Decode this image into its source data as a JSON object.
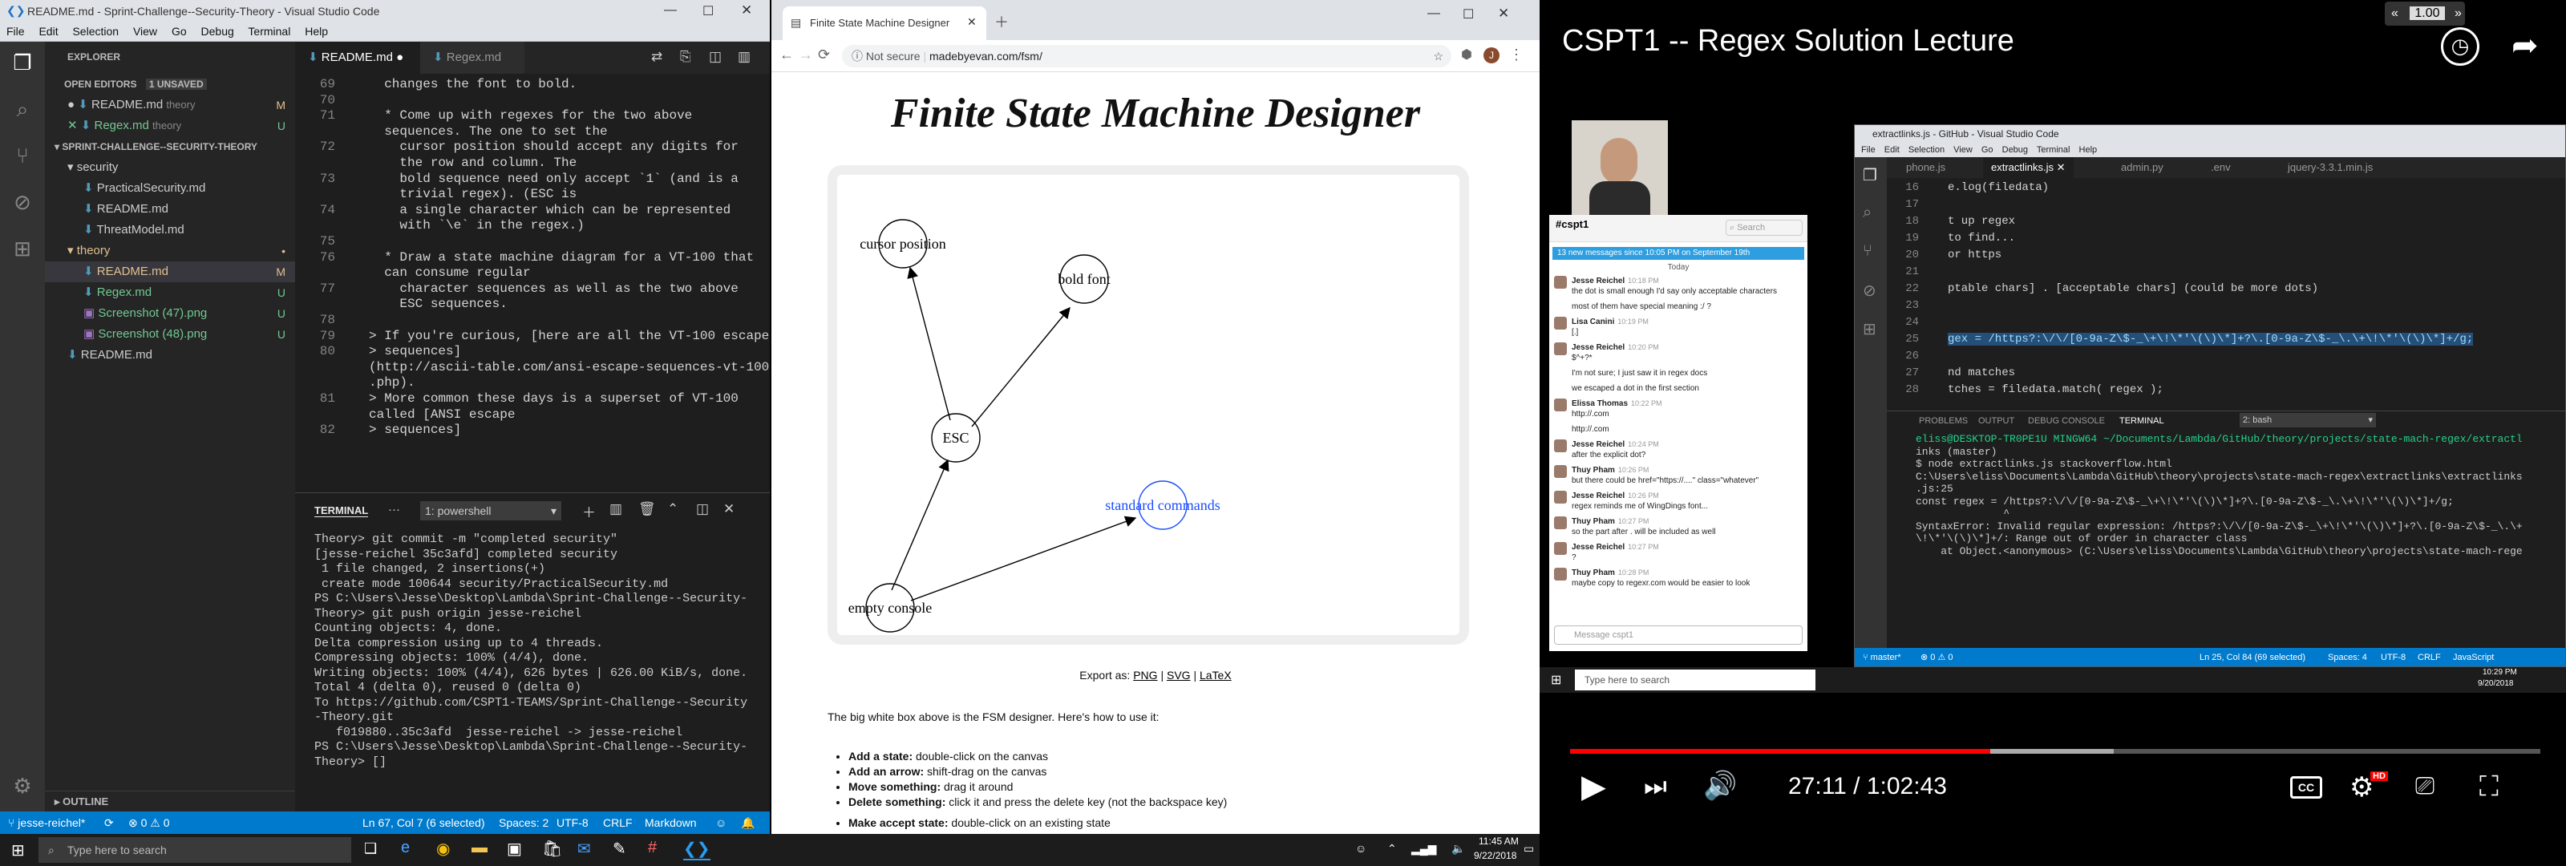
{
  "vscode": {
    "title": "README.md - Sprint-Challenge--Security-Theory - Visual Studio Code",
    "menu": [
      "File",
      "Edit",
      "Selection",
      "View",
      "Go",
      "Debug",
      "Terminal",
      "Help"
    ],
    "explorer_title": "EXPLORER",
    "open_editors": "OPEN EDITORS",
    "unsaved": "1 UNSAVED",
    "open_files": [
      {
        "name": "README.md",
        "dir": "theory",
        "mark": "M"
      },
      {
        "name": "Regex.md",
        "dir": "theory",
        "mark": "U"
      }
    ],
    "project": "SPRINT-CHALLENGE--SECURITY-THEORY",
    "tree": [
      {
        "name": "security",
        "kind": "folder",
        "mark": ""
      },
      {
        "name": "PracticalSecurity.md",
        "kind": "file",
        "mark": ""
      },
      {
        "name": "README.md",
        "kind": "file",
        "mark": ""
      },
      {
        "name": "ThreatModel.md",
        "kind": "file",
        "mark": ""
      },
      {
        "name": "theory",
        "kind": "folder",
        "mark": "•"
      },
      {
        "name": "README.md",
        "kind": "file",
        "mark": "M"
      },
      {
        "name": "Regex.md",
        "kind": "file",
        "mark": "U"
      },
      {
        "name": "Screenshot (47).png",
        "kind": "file",
        "mark": "U"
      },
      {
        "name": "Screenshot (48).png",
        "kind": "file",
        "mark": "U"
      },
      {
        "name": "README.md",
        "kind": "file-root",
        "mark": ""
      }
    ],
    "outline": "OUTLINE",
    "tabs": [
      {
        "label": "README.md",
        "active": true
      },
      {
        "label": "Regex.md",
        "active": false
      }
    ],
    "code": [
      {
        "n": "69",
        "t": "  changes the font to bold."
      },
      {
        "n": "70",
        "t": ""
      },
      {
        "n": "71",
        "t": "  * Come up with regexes for the two above"
      },
      {
        "n": "",
        "t": "  sequences. The one to set the"
      },
      {
        "n": "72",
        "t": "    cursor position should accept any digits for"
      },
      {
        "n": "",
        "t": "    the row and column. The"
      },
      {
        "n": "73",
        "t": "    bold sequence need only accept `1` (and is a"
      },
      {
        "n": "",
        "t": "    trivial regex). (ESC is"
      },
      {
        "n": "74",
        "t": "    a single character which can be represented"
      },
      {
        "n": "",
        "t": "    with `\\e` in the regex.)"
      },
      {
        "n": "75",
        "t": ""
      },
      {
        "n": "76",
        "t": "  * Draw a state machine diagram for a VT-100 that"
      },
      {
        "n": "",
        "t": "  can consume regular"
      },
      {
        "n": "77",
        "t": "    character sequences as well as the two above"
      },
      {
        "n": "",
        "t": "    ESC sequences."
      },
      {
        "n": "78",
        "t": ""
      },
      {
        "n": "79",
        "t": "> If you're curious, [here are all the VT-100 escape"
      },
      {
        "n": "80",
        "t": "> sequences]"
      },
      {
        "n": "",
        "t": "(http://ascii-table.com/ansi-escape-sequences-vt-100"
      },
      {
        "n": "",
        "t": ".php)."
      },
      {
        "n": "81",
        "t": "> More common these days is a superset of VT-100"
      },
      {
        "n": "",
        "t": "called [ANSI escape"
      },
      {
        "n": "82",
        "t": "> sequences]"
      }
    ],
    "panel_title": "TERMINAL",
    "panel_select": "1: powershell",
    "terminal": [
      "Theory> git commit -m \"completed security\"",
      "[jesse-reichel 35c3afd] completed security",
      " 1 file changed, 2 insertions(+)",
      " create mode 100644 security/PracticalSecurity.md",
      "PS C:\\Users\\Jesse\\Desktop\\Lambda\\Sprint-Challenge--Security-",
      "Theory> git push origin jesse-reichel",
      "Counting objects: 4, done.",
      "Delta compression using up to 4 threads.",
      "Compressing objects: 100% (4/4), done.",
      "Writing objects: 100% (4/4), 626 bytes | 626.00 KiB/s, done.",
      "",
      "Total 4 (delta 0), reused 0 (delta 0)",
      "To https://github.com/CSPT1-TEAMS/Sprint-Challenge--Security",
      "-Theory.git",
      "   f019880..35c3afd  jesse-reichel -> jesse-reichel",
      "PS C:\\Users\\Jesse\\Desktop\\Lambda\\Sprint-Challenge--Security-",
      "Theory> []"
    ],
    "status": {
      "branch": "jesse-reichel*",
      "errors": "⊗ 0 ⚠ 0",
      "pos": "Ln 67, Col 7 (6 selected)",
      "spaces": "Spaces: 2",
      "enc": "UTF-8",
      "eol": "CRLF",
      "lang": "Markdown"
    }
  },
  "chrome": {
    "tab": "Finite State Machine Designer",
    "not_secure": "Not secure",
    "url": "madebyevan.com/fsm/",
    "heading": "Finite State Machine Designer",
    "states": [
      "cursor position",
      "bold font",
      "ESC",
      "standard commands",
      "empty console"
    ],
    "export_label": "Export as:",
    "export_links": [
      "PNG",
      "SVG",
      "LaTeX"
    ],
    "intro": "The big white box above is the FSM designer.  Here's how to use it:",
    "howto": [
      {
        "k": "Add a state:",
        "v": "double-click on the canvas"
      },
      {
        "k": "Add an arrow:",
        "v": "shift-drag on the canvas"
      },
      {
        "k": "Move something:",
        "v": "drag it around"
      },
      {
        "k": "Delete something:",
        "v": "click it and press the delete key (not the backspace key)"
      }
    ],
    "accept": {
      "k": "Make accept state:",
      "v": "double-click on an existing state"
    }
  },
  "youtube": {
    "title": "CSPT1 -- Regex Solution Lecture",
    "speed": "1.00",
    "time": "27:11 / 1:02:43",
    "progress_fraction": 0.433,
    "inner_title": "extractlinks.js - GitHub - Visual Studio Code",
    "inner_menu": [
      "File",
      "Edit",
      "Selection",
      "View",
      "Go",
      "Debug",
      "Terminal",
      "Help"
    ],
    "inner_tabs": [
      "phone.js",
      "extractlinks.js",
      "admin.py",
      ".env",
      "jquery-3.3.1.min.js"
    ],
    "inner_code": [
      {
        "n": "16",
        "t": "e.log(filedata)"
      },
      {
        "n": "17",
        "t": ""
      },
      {
        "n": "18",
        "t": "t up regex"
      },
      {
        "n": "19",
        "t": "to find..."
      },
      {
        "n": "20",
        "t": "or https"
      },
      {
        "n": "21",
        "t": ""
      },
      {
        "n": "22",
        "t": "ptable chars] . [acceptable chars] (could be more dots)"
      },
      {
        "n": "23",
        "t": ""
      },
      {
        "n": "24",
        "t": ""
      },
      {
        "n": "25",
        "t": "gex = /https?:\\/\\/[0-9a-Z\\$-_\\+\\!\\*'\\(\\)\\*]+?\\.[0-9a-Z\\$-_\\.\\+\\!\\*'\\(\\)\\*]+/g;"
      },
      {
        "n": "26",
        "t": ""
      },
      {
        "n": "27",
        "t": "nd matches"
      },
      {
        "n": "28",
        "t": "tches = filedata.match( regex );"
      }
    ],
    "inner_panel_tabs": [
      "PROBLEMS",
      "OUTPUT",
      "DEBUG CONSOLE",
      "TERMINAL"
    ],
    "inner_panel_select": "2: bash",
    "inner_terminal": [
      "eliss@DESKTOP-TR0PE1U MINGW64 ~/Documents/Lambda/GitHub/theory/projects/state-mach-regex/extractl",
      "inks (master)",
      "$ node extractlinks.js stackoverflow.html",
      "C:\\Users\\eliss\\Documents\\Lambda\\GitHub\\theory\\projects\\state-mach-regex\\extractlinks\\extractlinks",
      ".js:25",
      "const regex = /https?:\\/\\/[0-9a-Z\\$-_\\+\\!\\*'\\(\\)\\*]+?\\.[0-9a-Z\\$-_\\.\\+\\!\\*'\\(\\)\\*]+/g;",
      "              ^",
      "",
      "SyntaxError: Invalid regular expression: /https?:\\/\\/[0-9a-Z\\$-_\\+\\!\\*'\\(\\)\\*]+?\\.[0-9a-Z\\$-_\\.\\+",
      "\\!\\*'\\(\\)\\*]+/: Range out of order in character class",
      "    at Object.<anonymous> (C:\\Users\\eliss\\Documents\\Lambda\\GitHub\\theory\\projects\\state-mach-rege"
    ],
    "inner_status": {
      "branch": "master*",
      "errs": "⊗ 0 ⚠ 0",
      "pos": "Ln 25, Col 84 (69 selected)",
      "spaces": "Spaces: 4",
      "enc": "UTF-8",
      "eol": "CRLF",
      "lang": "JavaScript"
    },
    "slack": {
      "channel": "cspt1",
      "search": "Search",
      "banner": "13 new messages since 10:05 PM on September 19th",
      "date": "Today",
      "messages": [
        {
          "u": "Jesse Reichel",
          "t": "10:18 PM",
          "m": "the dot is small enough I'd say only acceptable characters"
        },
        {
          "u": "",
          "t": "",
          "m": "most of them have special meaning :/ ?"
        },
        {
          "u": "Lisa Canini",
          "t": "10:19 PM",
          "m": "[.]"
        },
        {
          "u": "Jesse Reichel",
          "t": "10:20 PM",
          "m": "$^+?*"
        },
        {
          "u": "",
          "t": "",
          "m": "I'm not sure; I just saw it in regex docs"
        },
        {
          "u": "",
          "t": "",
          "m": "we escaped a dot in the first section"
        },
        {
          "u": "Elissa Thomas",
          "t": "10:22 PM",
          "m": "http://.com"
        },
        {
          "u": "",
          "t": "",
          "m": "http://.com"
        },
        {
          "u": "Jesse Reichel",
          "t": "10:24 PM",
          "m": "after the explicit dot?"
        },
        {
          "u": "Thuy Pham",
          "t": "10:26 PM",
          "m": "but there could be href=\"https://....\" class=\"whatever\""
        },
        {
          "u": "Jesse Reichel",
          "t": "10:26 PM",
          "m": "regex reminds me of WingDings font..."
        },
        {
          "u": "Thuy Pham",
          "t": "10:27 PM",
          "m": "so the part after . will be included as well"
        },
        {
          "u": "Jesse Reichel",
          "t": "10:27 PM",
          "m": "?"
        },
        {
          "u": "Thuy Pham",
          "t": "10:28 PM",
          "m": "maybe copy to regexr.com would be easier to look"
        }
      ],
      "composer": "Message cspt1"
    },
    "win_search": "Type here to search",
    "win_time": "10:29 PM",
    "win_date": "9/20/2018"
  },
  "taskbar": {
    "search": "Type here to search",
    "time": "11:45 AM",
    "date": "9/22/2018"
  }
}
